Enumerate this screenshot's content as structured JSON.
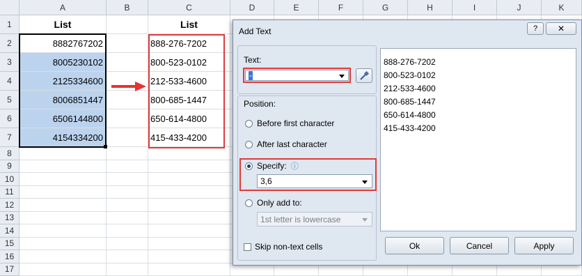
{
  "sheet": {
    "columns": [
      "A",
      "B",
      "C",
      "D",
      "E",
      "F",
      "G",
      "H",
      "I",
      "J",
      "K"
    ],
    "rows": [
      "1",
      "2",
      "3",
      "4",
      "5",
      "6",
      "7",
      "8",
      "9",
      "10",
      "11",
      "12",
      "13",
      "14",
      "15",
      "16",
      "17"
    ],
    "colA": {
      "header": "List",
      "values": [
        "8882767202",
        "8005230102",
        "2125334600",
        "8006851447",
        "6506144800",
        "4154334200"
      ]
    },
    "colC": {
      "header": "List",
      "values": [
        "888-276-7202",
        "800-523-0102",
        "212-533-4600",
        "800-685-1447",
        "650-614-4800",
        "415-433-4200"
      ]
    }
  },
  "dialog": {
    "title": "Add Text",
    "help_label": "?",
    "close_label": "✕",
    "text_label": "Text:",
    "text_value": "-",
    "position_label": "Position:",
    "options": {
      "before": "Before first character",
      "after": "After last character",
      "specify": "Specify:",
      "only_add": "Only add to:"
    },
    "info_icon": "ⓘ",
    "specify_value": "3,6",
    "only_add_value": "1st letter is lowercase",
    "skip_label": "Skip non-text cells",
    "buttons": {
      "ok": "Ok",
      "cancel": "Cancel",
      "apply": "Apply"
    },
    "preview": [
      "888-276-7202",
      "800-523-0102",
      "212-533-4600",
      "800-685-1447",
      "650-614-4800",
      "415-433-4200"
    ],
    "accent": "#e03a3a",
    "selected_option": "specify"
  }
}
